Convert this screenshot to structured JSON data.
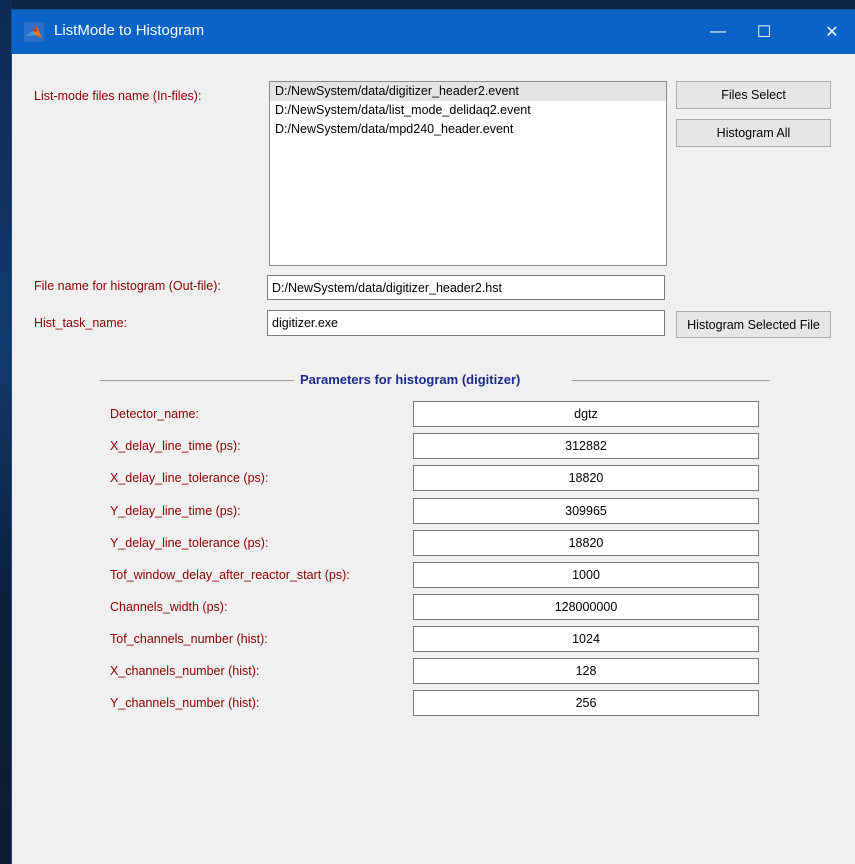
{
  "window": {
    "title": "ListMode to Histogram",
    "controls": {
      "minimize": "—",
      "maximize": "☐",
      "close": "✕"
    }
  },
  "infiles": {
    "label": "List-mode files name (In-files):",
    "items": [
      "D:/NewSystem/data/digitizer_header2.event",
      "D:/NewSystem/data/list_mode_delidaq2.event",
      "D:/NewSystem/data/mpd240_header.event"
    ],
    "selected_index": 0
  },
  "buttons": {
    "files_select": "Files Select",
    "histogram_all": "Histogram All",
    "histogram_selected": "Histogram Selected File"
  },
  "outfile": {
    "label": "File name for histogram (Out-file):",
    "value": "D:/NewSystem/data/digitizer_header2.hst"
  },
  "task": {
    "label": "Hist_task_name:",
    "value": "digitizer.exe"
  },
  "params": {
    "title": "Parameters for histogram (digitizer)",
    "rows": [
      {
        "label": "Detector_name:",
        "value": "dgtz"
      },
      {
        "label": "X_delay_line_time (ps):",
        "value": "312882"
      },
      {
        "label": "X_delay_line_tolerance (ps):",
        "value": "18820"
      },
      {
        "label": "Y_delay_line_time (ps):",
        "value": "309965"
      },
      {
        "label": "Y_delay_line_tolerance (ps):",
        "value": "18820"
      },
      {
        "label": "Tof_window_delay_after_reactor_start (ps):",
        "value": "1000"
      },
      {
        "label": "Channels_width (ps):",
        "value": "128000000"
      },
      {
        "label": "Tof_channels_number (hist):",
        "value": "1024"
      },
      {
        "label": "X_channels_number (hist):",
        "value": "128"
      },
      {
        "label": "Y_channels_number (hist):",
        "value": "256"
      }
    ]
  },
  "colors": {
    "titlebar": "#0a64c8",
    "label": "#8b0000",
    "group_title": "#1c2a8c",
    "window_bg": "#f0f0f0"
  }
}
